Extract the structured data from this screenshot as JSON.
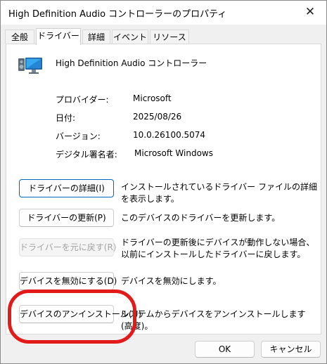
{
  "window": {
    "title": "High Definition Audio コントローラーのプロパティ",
    "close_glyph": "✕"
  },
  "tabs": [
    {
      "label": "全般"
    },
    {
      "label": "ドライバー"
    },
    {
      "label": "詳細"
    },
    {
      "label": "イベント"
    },
    {
      "label": "リソース"
    }
  ],
  "active_tab": "ドライバー",
  "device": {
    "name": "High Definition Audio コントローラー",
    "icon": "speaker-monitor-icon"
  },
  "properties": [
    {
      "label": "プロバイダー:",
      "value": "Microsoft"
    },
    {
      "label": "日付:",
      "value": "2025/08/26"
    },
    {
      "label": "バージョン:",
      "value": "10.0.26100.5074"
    },
    {
      "label": "デジタル署名者:",
      "value": "Microsoft Windows"
    }
  ],
  "actions": [
    {
      "label": "ドライバーの詳細(I)",
      "description": "インストールされているドライバー ファイルの詳細を表示します。",
      "enabled": true
    },
    {
      "label": "ドライバーの更新(P)",
      "description": "このデバイスのドライバーを更新します。",
      "enabled": true
    },
    {
      "label": "ドライバーを元に戻す(R)",
      "description": "ドライバーの更新後にデバイスが動作しない場合、以前にインストールしたドライバーに戻します。",
      "enabled": false
    },
    {
      "label": "デバイスを無効にする(D)",
      "description": "デバイスを無効にします。",
      "enabled": true
    },
    {
      "label": "デバイスのアンインストール(U)",
      "description": "システムからデバイスをアンインストールします (高度)。",
      "enabled": true,
      "highlighted": true
    }
  ],
  "footer": {
    "ok_label": "OK",
    "cancel_label": "キャンセル"
  },
  "colors": {
    "highlight_ring": "#e21a1a",
    "focus_border": "#0067c0",
    "disabled_text": "#a3a3a3"
  }
}
